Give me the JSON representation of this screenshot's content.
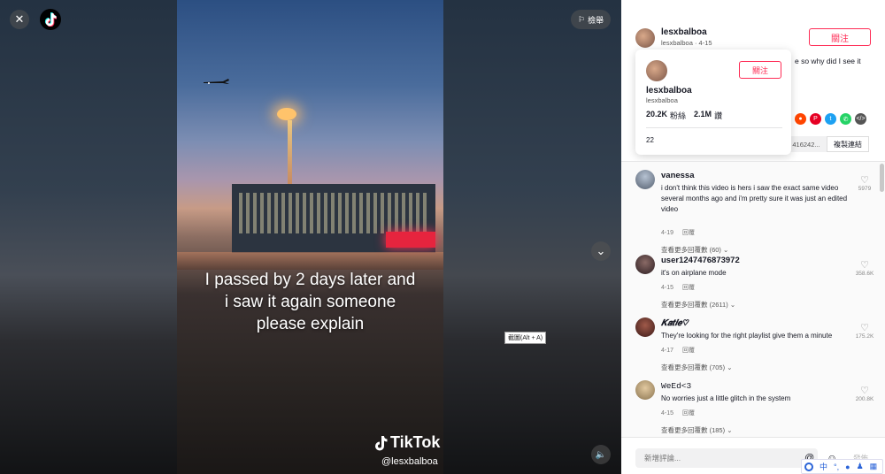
{
  "video": {
    "caption_lines": [
      "I passed by 2 days later and",
      "i saw it again someone",
      "please explain"
    ],
    "watermark_brand": "TikTok",
    "watermark_user": "@lesxbalboa",
    "report_label": "檢舉",
    "tooltip": "截圖(Alt + A)",
    "icons": {
      "close": "close-icon",
      "logo": "tiktok-logo-icon",
      "flag": "flag-icon",
      "down": "chevron-down-icon",
      "sound": "volume-icon"
    }
  },
  "author": {
    "username": "lesxbalboa",
    "subline": "lesxbalboa · 4-15",
    "follow_label": "關注",
    "description_fragment": "e so why did I see it"
  },
  "hover_card": {
    "username": "lesxbalboa",
    "handle": "lesxbalboa",
    "follow_label": "關注",
    "followers_count": "20.2K",
    "followers_label": "粉絲",
    "likes_count": "2.1M",
    "likes_label": "讚",
    "bio": "22"
  },
  "share": {
    "link_fragment": "416242...",
    "copy_link_label": "複製連結",
    "icons": [
      {
        "name": "reddit-icon",
        "color": "#ff4500"
      },
      {
        "name": "pinterest-icon",
        "color": "#e60023"
      },
      {
        "name": "twitter-icon",
        "color": "#1da1f2"
      },
      {
        "name": "whatsapp-icon",
        "color": "#25d366"
      },
      {
        "name": "embed-icon",
        "color": "#555555"
      }
    ]
  },
  "comments": [
    {
      "user": "vanessa",
      "text": "i don't think this video is hers i saw the exact same video several months ago and i'm pretty sure it was just an edited video",
      "date": "4-19",
      "reply": "回覆",
      "more": "查看更多回覆數 (60)",
      "likes": "5979"
    },
    {
      "user": "user1247476873972",
      "text": "it's on airplane mode",
      "date": "4-15",
      "reply": "回覆",
      "more": "查看更多回覆數 (2611)",
      "likes": "358.6K"
    },
    {
      "user": "𝑲𝒂𝒕𝒊𝒆♡",
      "text": "They're looking for the right playlist give them a minute",
      "date": "4-17",
      "reply": "回覆",
      "more": "查看更多回覆數 (705)",
      "likes": "175.2K"
    },
    {
      "user": "WeEd<3",
      "text": "No worries just a little glitch in the system",
      "date": "4-15",
      "reply": "回覆",
      "more": "查看更多回覆數 (185)",
      "likes": "200.8K"
    }
  ],
  "comment_bar": {
    "placeholder": "新增評論...",
    "post_label": "發佈"
  },
  "ime": {
    "lang": "中"
  }
}
